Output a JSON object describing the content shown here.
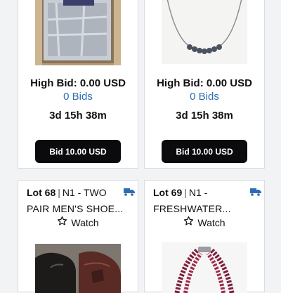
{
  "top_cards": [
    {
      "high_bid": "High Bid: 0.00 USD",
      "bids": "0 Bids",
      "time_left": "3d 15h 38m",
      "bid_button": "Bid 10.00 USD",
      "image": "box-of-grey-wrapped-items"
    },
    {
      "high_bid": "High Bid: 0.00 USD",
      "bids": "0 Bids",
      "time_left": "3d 15h 38m",
      "bid_button": "Bid 10.00 USD",
      "image": "beaded-necklace"
    }
  ],
  "bottom_cards": [
    {
      "lot": "Lot 68",
      "title_prefix": "N1 - TWO",
      "title": "PAIR MEN'S SHOE...",
      "watch": "Watch",
      "image": "mens-leather-shoes"
    },
    {
      "lot": "Lot 69",
      "title_prefix": "N1 -",
      "title": "FRESHWATER...",
      "watch": "Watch",
      "image": "pearl-necklace"
    }
  ],
  "colors": {
    "accent_blue": "#2f6db3",
    "button_bg": "#0b0b0d",
    "truck_icon": "#2f6db3"
  },
  "icons": [
    "truck-icon",
    "star-icon"
  ]
}
